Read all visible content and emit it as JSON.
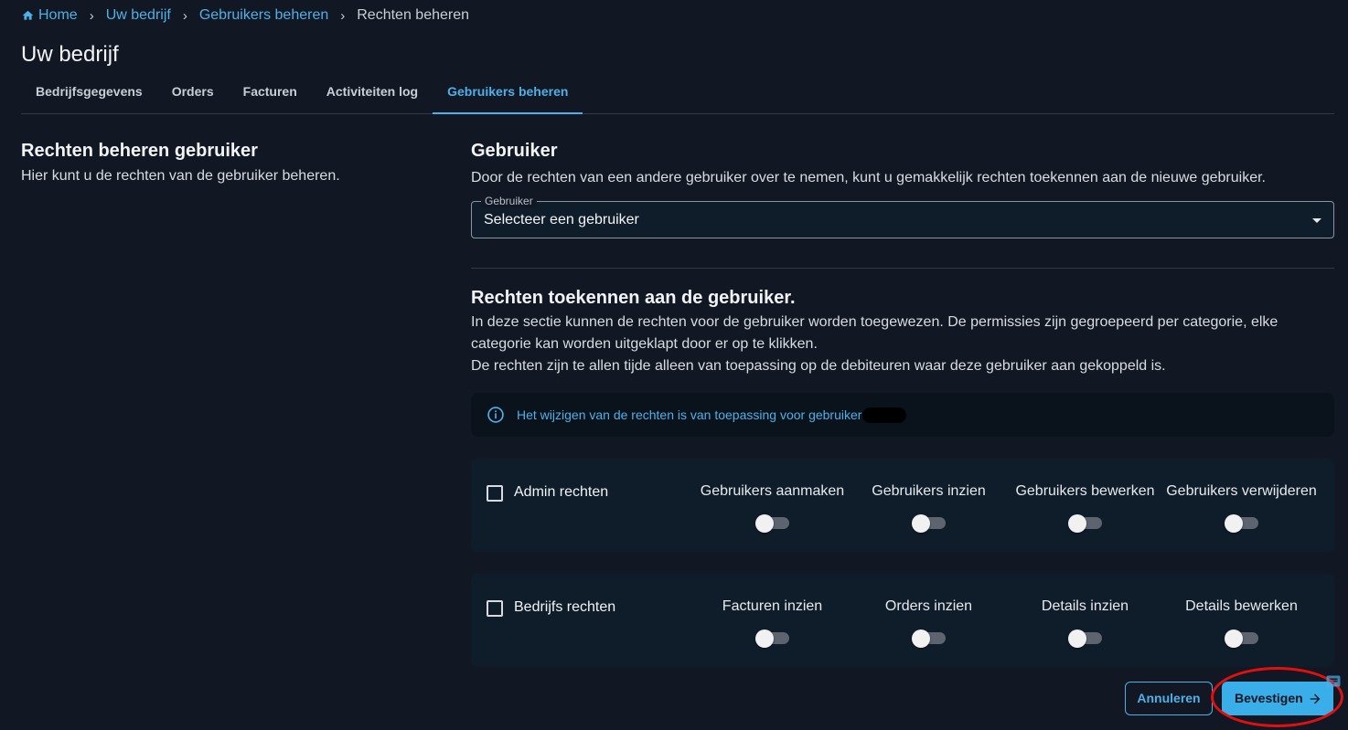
{
  "breadcrumb": {
    "home": "Home",
    "items": [
      "Uw bedrijf",
      "Gebruikers beheren"
    ],
    "current": "Rechten beheren",
    "separator": "›"
  },
  "page": {
    "title": "Uw bedrijf"
  },
  "tabs": [
    {
      "label": "Bedrijfsgegevens"
    },
    {
      "label": "Orders"
    },
    {
      "label": "Facturen"
    },
    {
      "label": "Activiteiten log"
    },
    {
      "label": "Gebruikers beheren",
      "active": true
    }
  ],
  "left": {
    "title": "Rechten beheren gebruiker",
    "description": "Hier kunt u de rechten van de gebruiker beheren."
  },
  "user_section": {
    "title": "Gebruiker",
    "description": "Door de rechten van een andere gebruiker over te nemen, kunt u gemakkelijk rechten toekennen aan de nieuwe gebruiker.",
    "select_label": "Gebruiker",
    "select_value": "Selecteer een gebruiker"
  },
  "rights_section": {
    "title": "Rechten toekennen aan de gebruiker.",
    "description_1": "In deze sectie kunnen de rechten voor de gebruiker worden toegewezen. De permissies zijn gegroepeerd per categorie, elke categorie kan worden uitgeklapt door er op te klikken.",
    "description_2": "De rechten zijn te allen tijde alleen van toepassing op de debiteuren waar deze gebruiker aan gekoppeld is."
  },
  "alert": {
    "text": "Het wijzigen van de rechten is van toepassing voor gebruiker"
  },
  "cards": [
    {
      "label": "Admin rechten",
      "checked": false,
      "permissions": [
        {
          "label": "Gebruikers aanmaken",
          "on": false
        },
        {
          "label": "Gebruikers inzien",
          "on": false
        },
        {
          "label": "Gebruikers bewerken",
          "on": false
        },
        {
          "label": "Gebruikers verwijderen",
          "on": false
        }
      ]
    },
    {
      "label": "Bedrijfs rechten",
      "checked": false,
      "permissions": [
        {
          "label": "Facturen inzien",
          "on": false
        },
        {
          "label": "Orders inzien",
          "on": false
        },
        {
          "label": "Details inzien",
          "on": false
        },
        {
          "label": "Details bewerken",
          "on": false
        }
      ]
    }
  ],
  "actions": {
    "cancel": "Annuleren",
    "confirm": "Bevestigen"
  },
  "colors": {
    "accent": "#4fb0e8",
    "background": "#111823",
    "card": "#0f1d2b",
    "highlight": "#e01010"
  },
  "icons": [
    "home-icon",
    "info-icon",
    "arrow-right-icon",
    "chat-icon",
    "chevron-right-icon",
    "caret-down-icon"
  ]
}
